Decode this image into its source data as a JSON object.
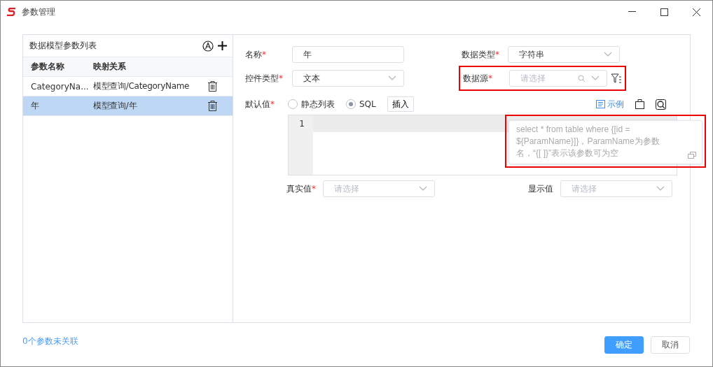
{
  "window": {
    "title": "参数管理"
  },
  "param_list": {
    "title": "数据模型参数列表",
    "columns": [
      "参数名称",
      "映射关系"
    ],
    "rows": [
      {
        "name": "CategoryNa...",
        "mapping": "模型查询/CategoryName",
        "selected": false
      },
      {
        "name": "年",
        "mapping": "模型查询/年",
        "selected": true
      }
    ]
  },
  "form": {
    "name": {
      "label": "名称",
      "required_mark": "*",
      "value": "年"
    },
    "data_type": {
      "label": "数据类型",
      "required_mark": "*",
      "value": "字符串"
    },
    "control_type": {
      "label": "控件类型",
      "required_mark": "*",
      "value": "文本"
    },
    "data_source": {
      "label": "数据源",
      "required_mark": "*",
      "placeholder": "请选择",
      "highlighted": true
    },
    "default_value": {
      "label": "默认值",
      "required_mark": "*",
      "options": [
        {
          "label": "静态列表",
          "selected": false
        },
        {
          "label": "SQL",
          "selected": true
        }
      ],
      "insert_button": "插入"
    },
    "editor": {
      "example_link": "示例",
      "line_numbers": [
        "1"
      ]
    },
    "tooltip": {
      "text": "select * from table where {[id = ${ParamName}]}，ParamName为参数名，“{[ ]}”表示该参数可为空",
      "highlighted": true
    },
    "real_value": {
      "label": "真实值",
      "required_mark": "*",
      "placeholder": "请选择"
    },
    "display_value": {
      "label": "显示值",
      "placeholder": "请选择"
    }
  },
  "footer": {
    "unlinked": "0个参数未关联",
    "buttons": [
      {
        "label": "确定",
        "kind": "primary"
      },
      {
        "label": "取消",
        "kind": "secondary"
      }
    ]
  }
}
